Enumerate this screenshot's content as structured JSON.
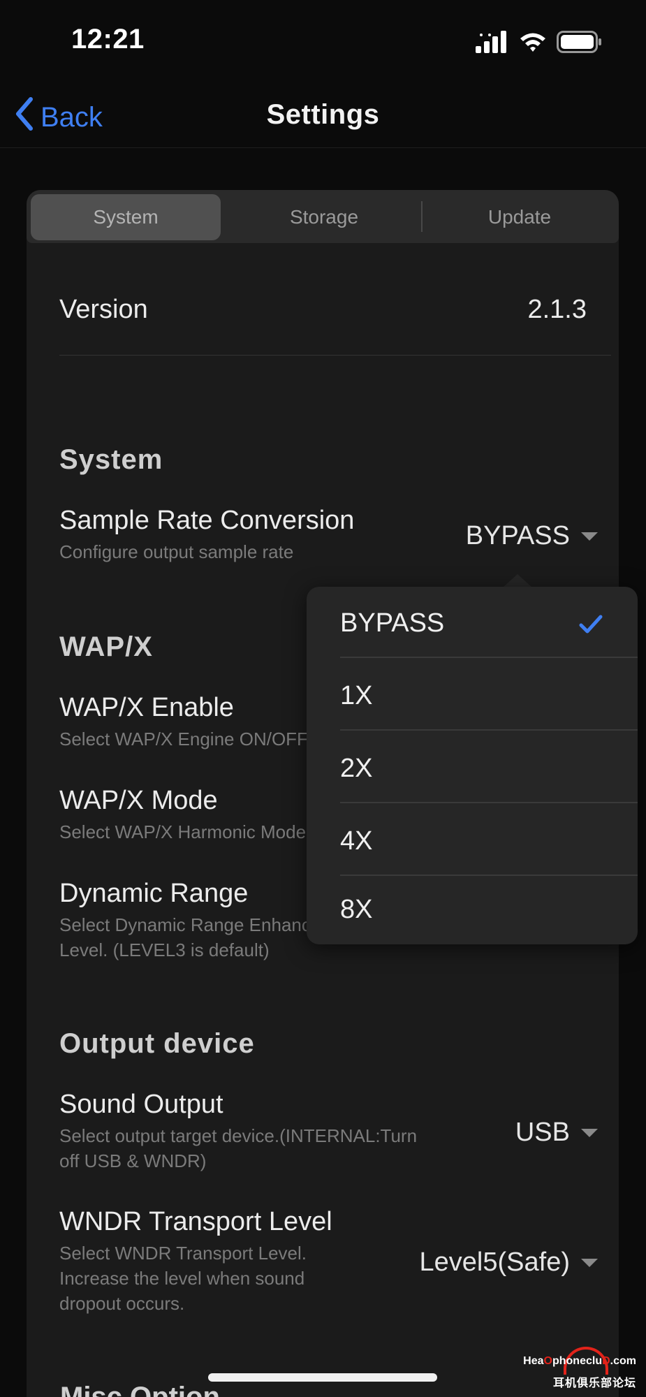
{
  "status": {
    "time": "12:21"
  },
  "nav": {
    "back_label": "Back",
    "title": "Settings"
  },
  "tabs": [
    {
      "label": "System",
      "selected": true
    },
    {
      "label": "Storage",
      "selected": false
    },
    {
      "label": "Update",
      "selected": false
    }
  ],
  "version": {
    "label": "Version",
    "value": "2.1.3"
  },
  "sections": {
    "system": {
      "title": "System",
      "sample_rate": {
        "title": "Sample Rate Conversion",
        "subtitle": "Configure output sample rate",
        "value": "BYPASS"
      }
    },
    "wapx": {
      "title": "WAP/X",
      "enable": {
        "title": "WAP/X Enable",
        "subtitle": "Select WAP/X Engine ON/OFF"
      },
      "mode": {
        "title": "WAP/X Mode",
        "subtitle": "Select WAP/X Harmonic Mode"
      },
      "dynamic_range": {
        "title": "Dynamic Range",
        "subtitle_line1": "Select Dynamic Range Enhancement",
        "subtitle_line2": "Level. (LEVEL3 is default)"
      }
    },
    "output_device": {
      "title": "Output device",
      "sound_output": {
        "title": "Sound Output",
        "subtitle_line1": "Select output target device.(INTERNAL:Turn",
        "subtitle_line2": "off USB & WNDR)",
        "value": "USB"
      },
      "wndr": {
        "title": "WNDR Transport Level",
        "subtitle_line1": "Select WNDR Transport Level.",
        "subtitle_line2": "Increase the level when sound",
        "subtitle_line3": "dropout occurs.",
        "value": "Level5(Safe)"
      }
    },
    "misc": {
      "title": "Misc Option"
    }
  },
  "popover": {
    "options": [
      "BYPASS",
      "1X",
      "2X",
      "4X",
      "8X"
    ],
    "selected": "BYPASS",
    "check_color": "#3f7ff2"
  },
  "watermark": {
    "line1_a": "Hea",
    "line1_b": "phonecl",
    "line1_c": "u",
    "line1_d": "D",
    "line1_e": ".com",
    "line2": "耳机俱乐部论坛"
  },
  "colors": {
    "accent": "#3f7ff2",
    "background": "#0b0b0b",
    "card": "#1b1b1b"
  }
}
